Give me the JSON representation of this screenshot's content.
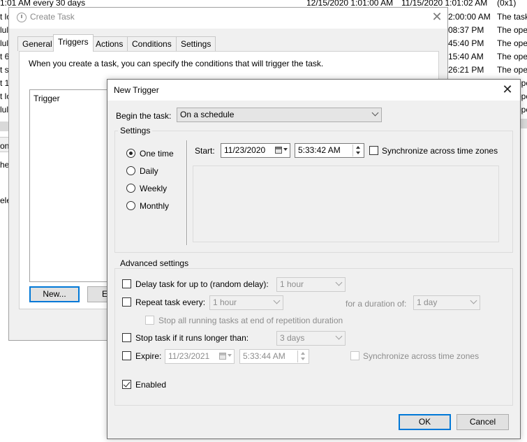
{
  "background": {
    "rows": [
      {
        "left": "1:01 AM every 30 days",
        "date1": "12/15/2020 1:01:00 AM",
        "date2": "11/15/2020 1:01:02 AM",
        "result": "(0x1)"
      },
      {
        "left": "t lo",
        "time": "2:00:00 AM",
        "desc": "The task"
      },
      {
        "left": "lul",
        "time": "08:37 PM",
        "desc": "The ope"
      },
      {
        "left": "lul",
        "time": "45:40 PM",
        "desc": "The ope"
      },
      {
        "left": "t 6",
        "time": "15:40 AM",
        "desc": "The ope"
      },
      {
        "left": "t s",
        "time": "26:21 PM",
        "desc": "The ope"
      },
      {
        "left": "t 1",
        "desc": "ope"
      },
      {
        "left": "t lo",
        "desc": "ope"
      },
      {
        "left": "lul",
        "desc": "ope"
      }
    ],
    "side_fragments": [
      "on",
      "he",
      "ele"
    ]
  },
  "create_task": {
    "title": "Create Task",
    "tabs": [
      "General",
      "Triggers",
      "Actions",
      "Conditions",
      "Settings"
    ],
    "active_tab": "Triggers",
    "description": "When you create a task, you can specify the conditions that will trigger the task.",
    "list_header": "Trigger",
    "new_button": "New...",
    "edit_button_fragment": "Ed"
  },
  "new_trigger": {
    "title": "New Trigger",
    "begin_label": "Begin the task:",
    "begin_value": "On a schedule",
    "settings_label": "Settings",
    "schedule_options": [
      "One time",
      "Daily",
      "Weekly",
      "Monthly"
    ],
    "selected_schedule": "One time",
    "start_label": "Start:",
    "start_date": "11/23/2020",
    "start_time": "5:33:42 AM",
    "sync_label": "Synchronize across time zones",
    "advanced_label": "Advanced settings",
    "delay_label": "Delay task for up to (random delay):",
    "delay_value": "1 hour",
    "repeat_label": "Repeat task every:",
    "repeat_value": "1 hour",
    "duration_label": "for a duration of:",
    "duration_value": "1 day",
    "stop_all_label": "Stop all running tasks at end of repetition duration",
    "stop_if_label": "Stop task if it runs longer than:",
    "stop_if_value": "3 days",
    "expire_label": "Expire:",
    "expire_date": "11/23/2021",
    "expire_time": "5:33:44 AM",
    "expire_sync_label": "Synchronize across time zones",
    "enabled_label": "Enabled",
    "enabled_checked": true,
    "ok_label": "OK",
    "cancel_label": "Cancel"
  }
}
